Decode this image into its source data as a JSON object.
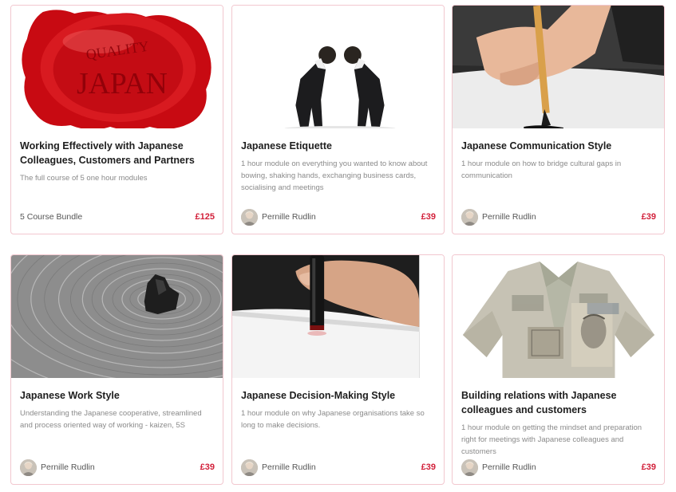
{
  "courses": [
    {
      "title": "Working Effectively with Japanese Colleagues, Customers and Partners",
      "description": "The full course of 5 one hour modules",
      "footer_label": "5 Course Bundle",
      "price": "£125",
      "image": "red-wax-seal-quality-japan",
      "seal_text_top": "QUALITY",
      "seal_text_main": "JAPAN"
    },
    {
      "title": "Japanese Etiquette",
      "description": "1 hour module on everything you wanted to know about bowing, shaking hands, exchanging business cards, socialising and meetings",
      "author": "Pernille Rudlin",
      "price": "£39",
      "image": "two-businessmen-bowing"
    },
    {
      "title": "Japanese Communication Style",
      "description": "1 hour module on how to bridge cultural gaps in communication",
      "author": "Pernille Rudlin",
      "price": "£39",
      "image": "calligraphy-brush-hand"
    },
    {
      "title": "Japanese Work Style",
      "description": "Understanding the Japanese cooperative, streamlined and process oriented way of working - kaizen, 5S",
      "author": "Pernille Rudlin",
      "price": "£39",
      "image": "zen-rock-garden"
    },
    {
      "title": "Japanese Decision-Making Style",
      "description": "1 hour module on why Japanese organisations take so long to make decisions.",
      "author": "Pernille Rudlin",
      "price": "£39",
      "image": "hanko-stamp-hand"
    },
    {
      "title": "Building relations with Japanese colleagues and customers",
      "description": "1 hour module on getting the mindset and preparation right for meetings with Japanese colleagues and customers",
      "author": "Pernille Rudlin",
      "price": "£39",
      "image": "origami-yen-shirt"
    }
  ],
  "colors": {
    "price": "#d2203a",
    "border": "#f2c7cf"
  }
}
